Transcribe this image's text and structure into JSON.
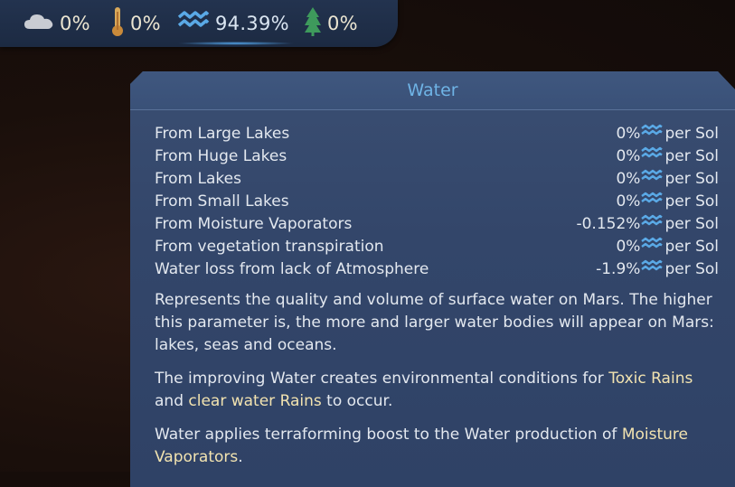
{
  "top_bar": {
    "clouds": {
      "icon": "cloud-icon",
      "value": "0%"
    },
    "temperature": {
      "icon": "thermometer-icon",
      "value": "0%"
    },
    "water": {
      "icon": "water-waves-icon",
      "value": "94.39%"
    },
    "vegetation": {
      "icon": "tree-icon",
      "value": "0%"
    }
  },
  "panel": {
    "title": "Water",
    "rows": [
      {
        "label": "From Large Lakes",
        "value": "0%",
        "unit": "per Sol"
      },
      {
        "label": "From Huge Lakes",
        "value": "0%",
        "unit": "per Sol"
      },
      {
        "label": "From Lakes",
        "value": "0%",
        "unit": "per Sol"
      },
      {
        "label": "From Small Lakes",
        "value": "0%",
        "unit": "per Sol"
      },
      {
        "label": "From Moisture Vaporators",
        "value": "-0.152%",
        "unit": "per Sol"
      },
      {
        "label": "From vegetation transpiration",
        "value": "0%",
        "unit": "per Sol"
      },
      {
        "label": "Water loss from lack of Atmosphere",
        "value": "-1.9%",
        "unit": "per Sol"
      }
    ],
    "desc1": "Represents the quality and volume of surface water on Mars. The higher this parameter is, the more and larger water bodies will appear on Mars: lakes, seas and oceans.",
    "desc2": {
      "a": "The improving Water creates environmental conditions for ",
      "toxic": "Toxic Rains",
      "b": " and ",
      "clear": "clear water Rains",
      "c": " to occur."
    },
    "desc3": {
      "a": "Water applies terraforming boost to the Water production of ",
      "vap": "Moisture Vaporators",
      "b": "."
    }
  },
  "colors": {
    "title": "#6fb4e6",
    "highlight": "#f2e3b0",
    "water_icon": "#5aa9e6",
    "tree_icon": "#3e9a5c"
  }
}
